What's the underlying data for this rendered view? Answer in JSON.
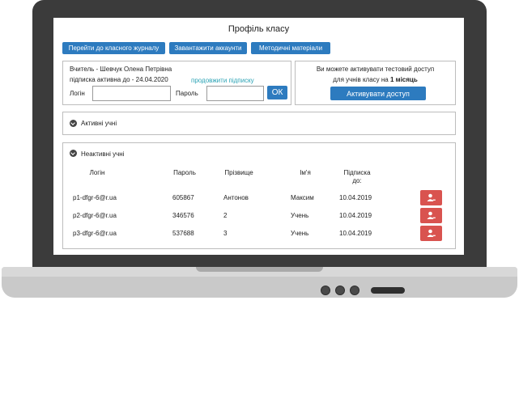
{
  "page": {
    "title": "Профіль класу"
  },
  "toolbar": {
    "journal_label": "Перейти до класного журналу",
    "upload_label": "Завантажити аккаунти",
    "materials_label": "Методичні матеріали"
  },
  "teacher": {
    "name_line": "Вчитель - Шевчук Олена Петрівна",
    "subscription_line": "підписка активна до - 24.04.2020",
    "extend_link": "продовжити підписку",
    "login_label": "Логін",
    "password_label": "Пароль",
    "ok_label": "ОК"
  },
  "trial": {
    "line1": "Ви можете активувати тестовий доступ",
    "line2_prefix": "для учнів класу на ",
    "line2_bold": "1 місяць",
    "activate_label": "Активувати доступ"
  },
  "active_section": {
    "label": "Активні учні"
  },
  "inactive_section": {
    "label": "Неактивні учні",
    "columns": [
      "Логін",
      "Пароль",
      "Прізвище",
      "Ім'я",
      "Підписка",
      "до:"
    ],
    "rows": [
      {
        "login": "p1-dfgr-6@r.ua",
        "password": "605867",
        "surname": "Антонов",
        "name": "Максим",
        "date": "10.04.2019"
      },
      {
        "login": "p2-dfgr-6@r.ua",
        "password": "346576",
        "surname": "2",
        "name": "Учень",
        "date": "10.04.2019"
      },
      {
        "login": "p3-dfgr-6@r.ua",
        "password": "537688",
        "surname": "3",
        "name": "Учень",
        "date": "10.04.2019"
      }
    ]
  },
  "colors": {
    "accent": "#2d7bbf",
    "danger": "#d9534f",
    "link": "#2aa2b4",
    "laptop": "#3b3b3b"
  },
  "icons": {
    "section_toggle": "chevron-down-icon",
    "row_action": "user-remove-icon"
  }
}
